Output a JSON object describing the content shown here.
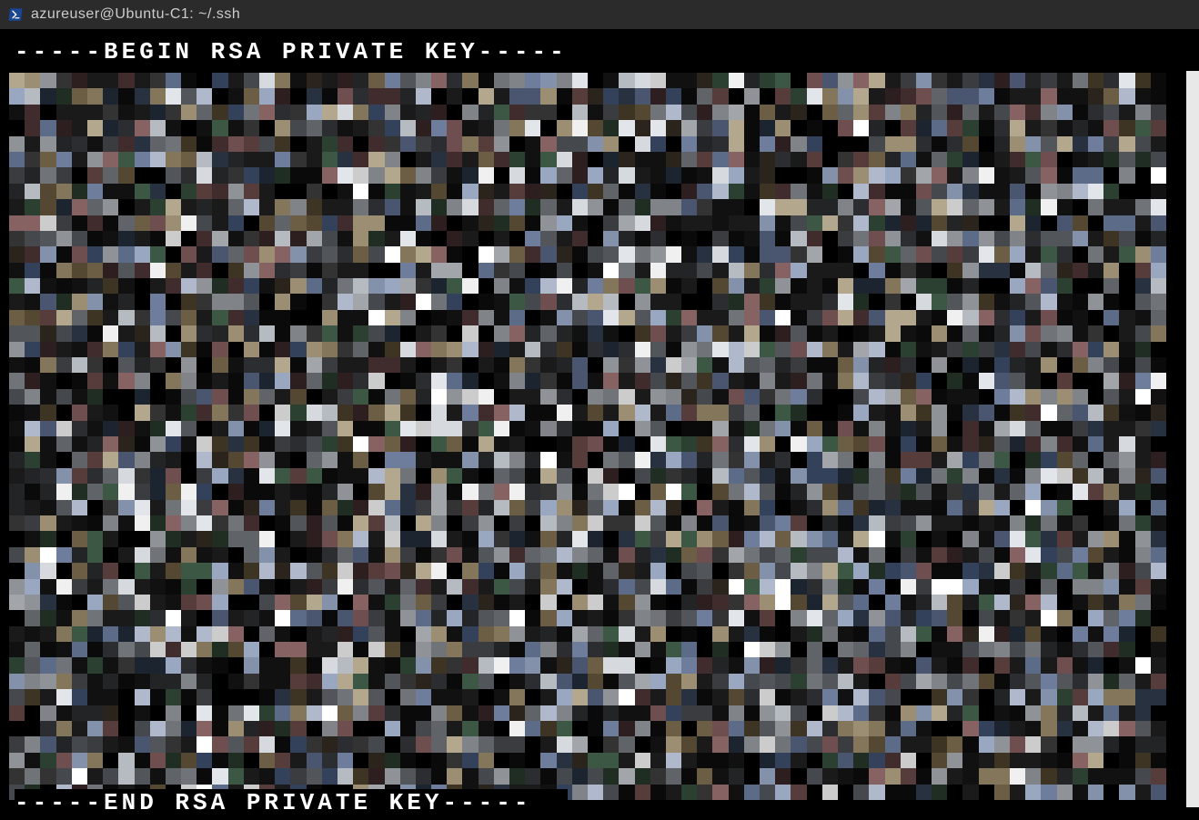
{
  "window": {
    "title": "azureuser@Ubuntu-C1: ~/.ssh"
  },
  "terminal": {
    "key_header": "-----BEGIN RSA PRIVATE KEY-----",
    "key_footer": "-----END RSA PRIVATE KEY-----",
    "body_redacted": true,
    "body_note": "The body of the RSA private key is pixelated / blurred out and illegible in the screenshot.",
    "body_line_count": 25
  },
  "pixelation": {
    "rows": 46,
    "cols": 74,
    "palette": [
      "#000000",
      "#0a0a0a",
      "#111111",
      "#1a1a1a",
      "#222426",
      "#2b2d30",
      "#333333",
      "#3a3c40",
      "#45484c",
      "#52555a",
      "#606469",
      "#707479",
      "#808489",
      "#8f9398",
      "#a2a6ab",
      "#b6bbc2",
      "#cccccc",
      "#d6d9de",
      "#e2e5ea",
      "#f0f0f0",
      "#ffffff",
      "#1c2430",
      "#273140",
      "#33415a",
      "#4a5670",
      "#5c6b88",
      "#6e7d9c",
      "#8491ab",
      "#9aa7c0",
      "#b0b9cc",
      "#2a241c",
      "#3d3424",
      "#544832",
      "#6c5e44",
      "#83765a",
      "#9b8e73",
      "#b3a78e",
      "#2d1f1f",
      "#402c2c",
      "#573c3c",
      "#6e4e4e",
      "#866262",
      "#1f2d23",
      "#2c4032",
      "#3c5744",
      "#000000"
    ]
  }
}
